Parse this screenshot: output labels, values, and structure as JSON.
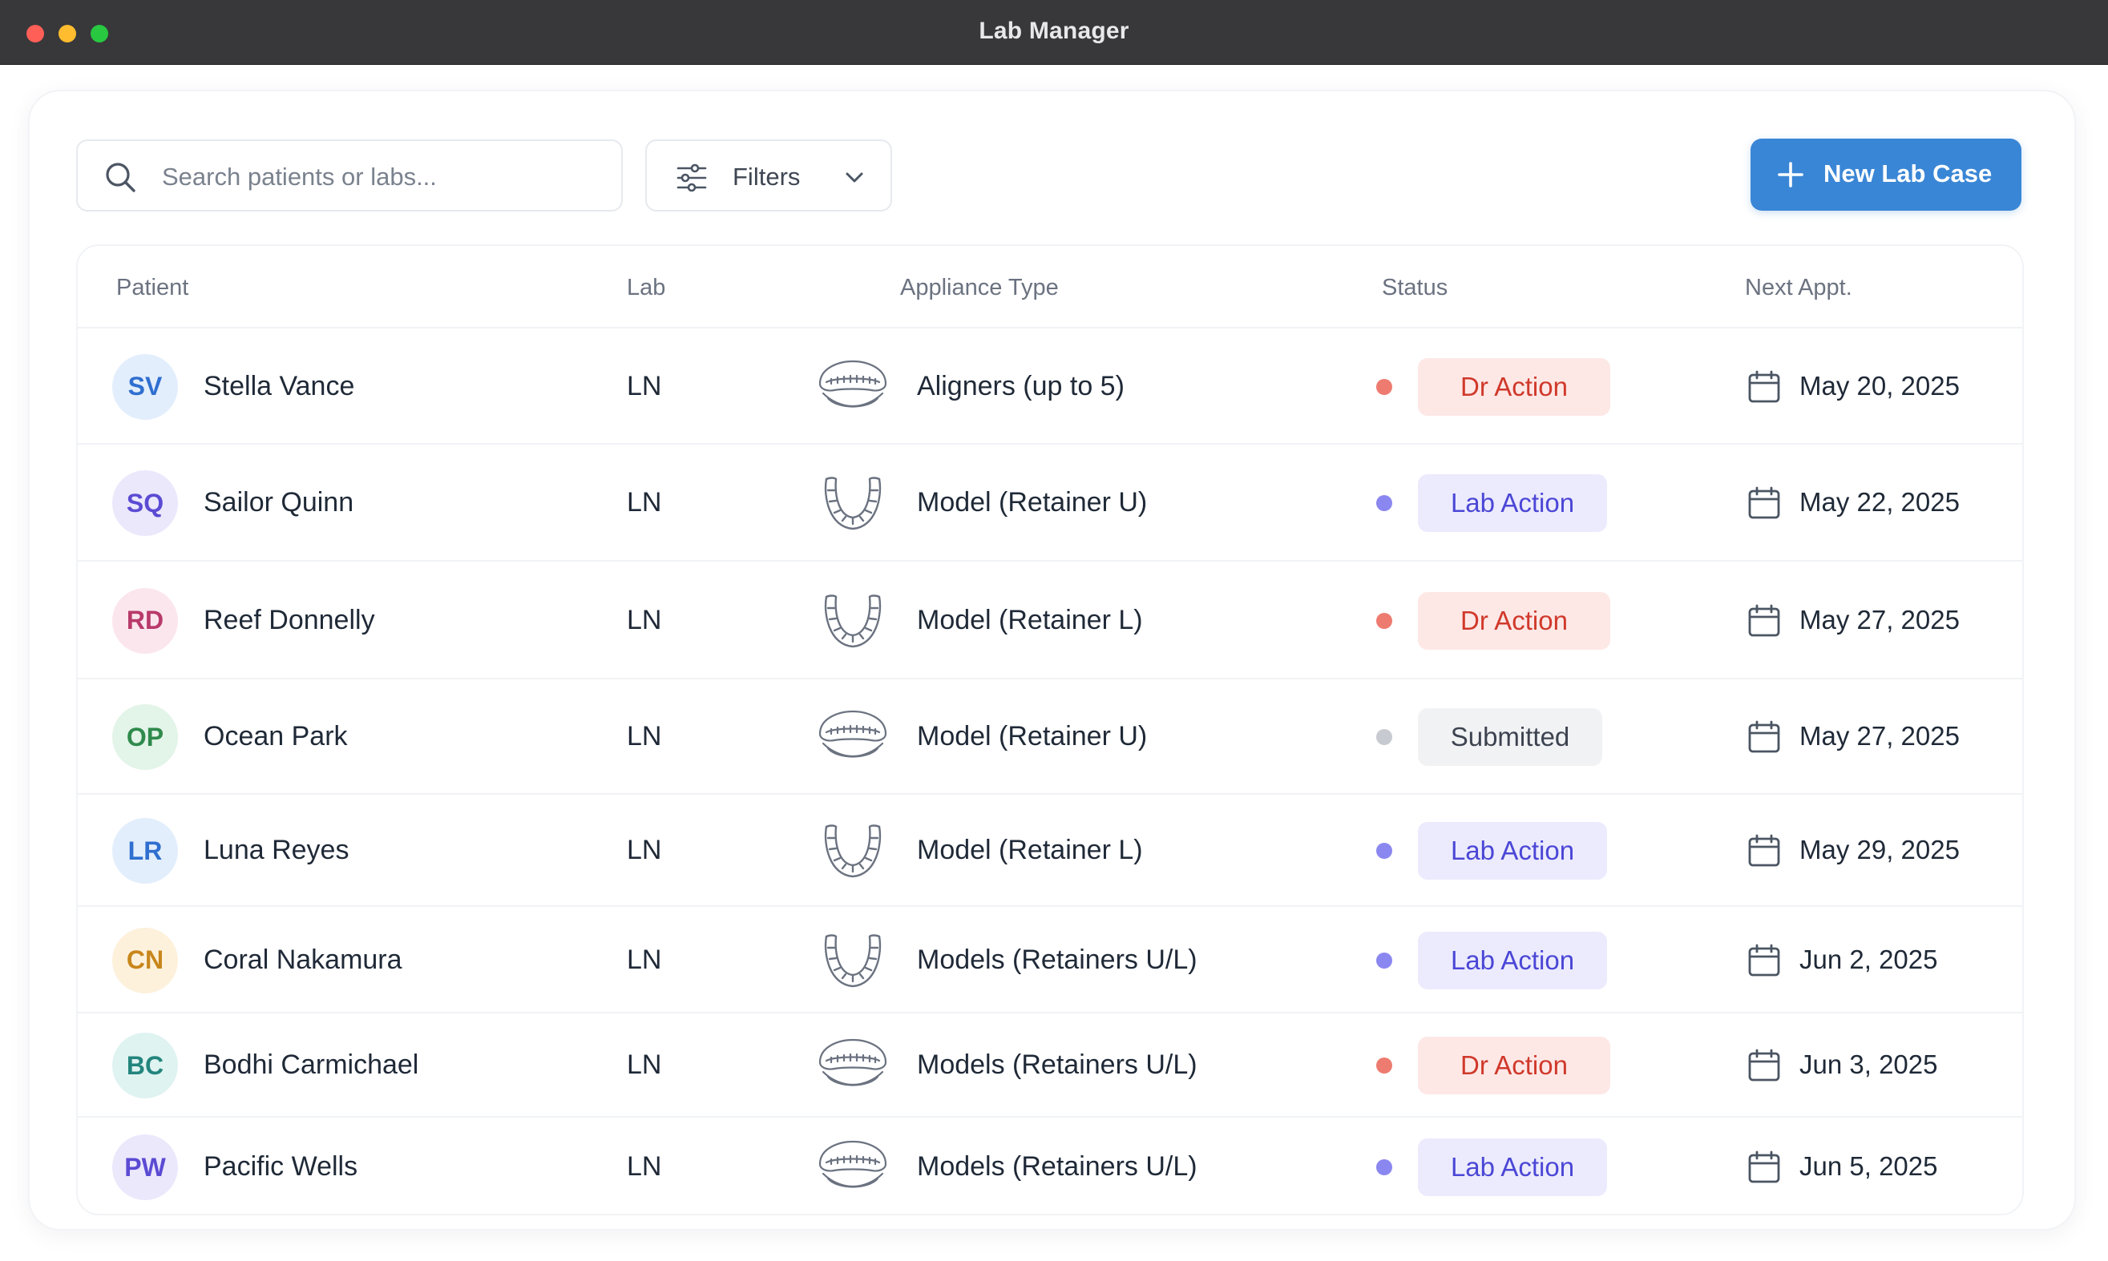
{
  "window": {
    "title": "Lab Manager"
  },
  "toolbar": {
    "search_placeholder": "Search patients or labs...",
    "filters_label": "Filters",
    "new_case_label": "New Lab Case"
  },
  "colors": {
    "accent": "#3a86d6",
    "dr_action_bg": "#fde8e6",
    "dr_action_text": "#d0392b",
    "dr_action_dot": "#ee7b70",
    "lab_action_bg": "#ecebfd",
    "lab_action_text": "#4b47d6",
    "lab_action_dot": "#8b87f0",
    "submitted_bg": "#f1f2f4",
    "submitted_text": "#3d4350",
    "submitted_dot": "#c7cbd1"
  },
  "table": {
    "headers": {
      "patient": "Patient",
      "lab": "Lab",
      "appliance": "Appliance Type",
      "status": "Status",
      "next_appt": "Next Appt."
    },
    "rows": [
      {
        "initials": "SV",
        "name": "Stella Vance",
        "lab": "LN",
        "appliance_icon": "aligner-tray-icon",
        "appliance": "Aligners (up to 5)",
        "status": "Dr Action",
        "status_kind": "dr",
        "date": "May 20, 2025",
        "avatar_bg": "#e3eefc",
        "avatar_fg": "#2f6fd0"
      },
      {
        "initials": "SQ",
        "name": "Sailor Quinn",
        "lab": "LN",
        "appliance_icon": "dental-arch-icon",
        "appliance": "Model (Retainer U)",
        "status": "Lab Action",
        "status_kind": "lab",
        "date": "May 22, 2025",
        "avatar_bg": "#ebe8fc",
        "avatar_fg": "#5b4bd3"
      },
      {
        "initials": "RD",
        "name": "Reef Donnelly",
        "lab": "LN",
        "appliance_icon": "dental-arch-icon",
        "appliance": "Model (Retainer L)",
        "status": "Dr Action",
        "status_kind": "dr",
        "date": "May 27, 2025",
        "avatar_bg": "#fbe6ee",
        "avatar_fg": "#b83a6a"
      },
      {
        "initials": "OP",
        "name": "Ocean Park",
        "lab": "LN",
        "appliance_icon": "aligner-tray-icon",
        "appliance": "Model (Retainer U)",
        "status": "Submitted",
        "status_kind": "submitted",
        "date": "May 27, 2025",
        "avatar_bg": "#e3f4e8",
        "avatar_fg": "#2f8a4c"
      },
      {
        "initials": "LR",
        "name": "Luna Reyes",
        "lab": "LN",
        "appliance_icon": "dental-arch-icon",
        "appliance": "Model (Retainer L)",
        "status": "Lab Action",
        "status_kind": "lab",
        "date": "May 29, 2025",
        "avatar_bg": "#e3eefc",
        "avatar_fg": "#2f6fd0"
      },
      {
        "initials": "CN",
        "name": "Coral Nakamura",
        "lab": "LN",
        "appliance_icon": "dental-arch-icon",
        "appliance": "Models (Retainers U/L)",
        "status": "Lab Action",
        "status_kind": "lab",
        "date": "Jun 2, 2025",
        "avatar_bg": "#fdf1dc",
        "avatar_fg": "#c8861b"
      },
      {
        "initials": "BC",
        "name": "Bodhi Carmichael",
        "lab": "LN",
        "appliance_icon": "aligner-tray-icon",
        "appliance": "Models (Retainers U/L)",
        "status": "Dr Action",
        "status_kind": "dr",
        "date": "Jun 3, 2025",
        "avatar_bg": "#dff3f1",
        "avatar_fg": "#23857d"
      },
      {
        "initials": "PW",
        "name": "Pacific Wells",
        "lab": "LN",
        "appliance_icon": "aligner-tray-icon",
        "appliance": "Models (Retainers U/L)",
        "status": "Lab Action",
        "status_kind": "lab",
        "date": "Jun 5, 2025",
        "avatar_bg": "#ebe8fc",
        "avatar_fg": "#5b4bd3"
      }
    ]
  }
}
